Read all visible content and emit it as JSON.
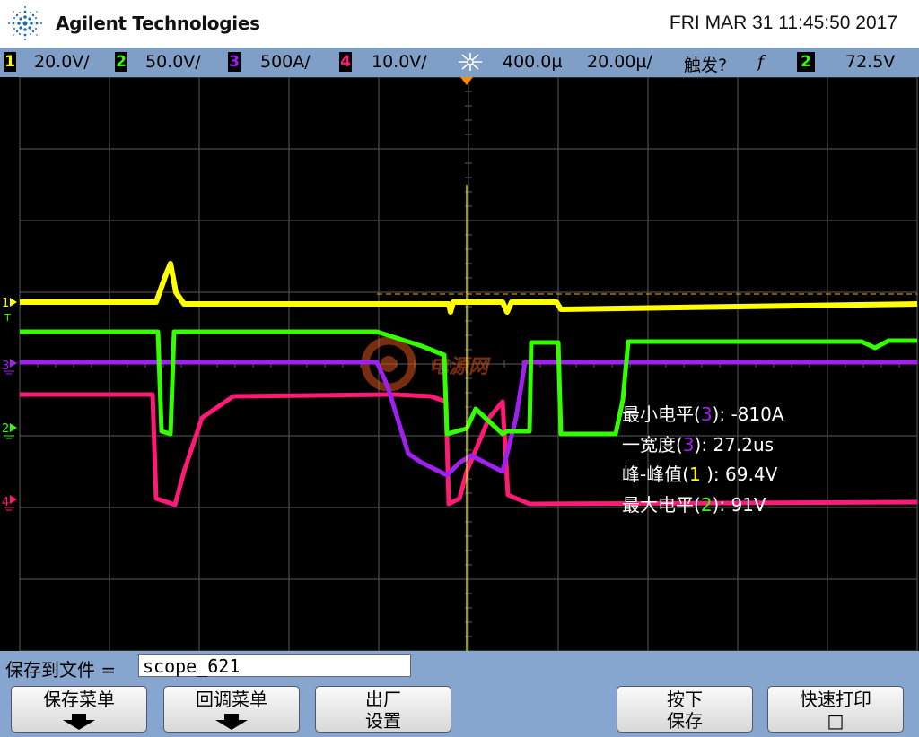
{
  "header": {
    "brand": "Agilent Technologies",
    "datetime": "FRI MAR 31 11:45:50 2017"
  },
  "status": {
    "channels": [
      {
        "num": "1",
        "scale": "20.0V/",
        "color": "#ffff00"
      },
      {
        "num": "2",
        "scale": "50.0V/",
        "color": "#33ff00"
      },
      {
        "num": "3",
        "scale": "500A/",
        "color": "#a020f0"
      },
      {
        "num": "4",
        "scale": "10.0V/",
        "color": "#ff1a75"
      }
    ],
    "delay": "400.0µ",
    "timebase": "20.00µ/",
    "trigger_label": "触发?",
    "trigger_slope": "f",
    "trigger_channel": "2",
    "trigger_level": "72.5V"
  },
  "measurements": [
    {
      "name": "最小电平",
      "ch": "3",
      "sep": "): ",
      "value": "-810A",
      "color": "#a020f0"
    },
    {
      "name": "一宽度",
      "ch": "3",
      "sep": "): ",
      "value": "27.2us",
      "color": "#a020f0"
    },
    {
      "name": "峰-峰值",
      "ch": "1",
      "sep": " ): ",
      "value": "69.4V",
      "color": "#ffff00"
    },
    {
      "name": "最大电平",
      "ch": "2",
      "sep": "): ",
      "value": "91V",
      "color": "#33ff00"
    }
  ],
  "file": {
    "label": "保存到文件 =",
    "filename": "scope_621"
  },
  "softkeys": [
    {
      "line1": "保存菜单",
      "line2": "",
      "arrow": true
    },
    {
      "line1": "回调菜单",
      "line2": "",
      "arrow": true
    },
    {
      "line1": "出厂",
      "line2": "设置",
      "arrow": false
    },
    {
      "line1": "按下",
      "line2": "保存",
      "arrow": false
    },
    {
      "line1": "快速打印",
      "line2": "□",
      "arrow": false
    }
  ],
  "watermark": "电源网",
  "colors": {
    "ch1": "#ffff00",
    "ch2": "#33ff00",
    "ch3": "#a020f0",
    "ch4": "#ff1a75",
    "grid": "#5a5a5a",
    "trigger_marker": "#ff8c00"
  },
  "icons": {
    "logo": "agilent-spark-logo",
    "delay": "delay-spark-icon",
    "arrow": "down-arrow-icon"
  }
}
